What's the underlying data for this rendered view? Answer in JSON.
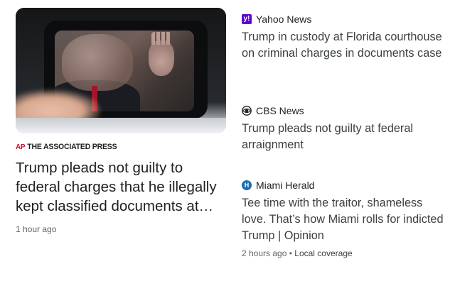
{
  "top_story": {
    "image_alt": "Photo of a person waving from behind a car window",
    "source": {
      "logo_text": "AP",
      "name": "THE ASSOCIATED PRESS"
    },
    "headline": "Trump pleads not guilty to federal charges that he illegally kept classified documents at…",
    "time": "1 hour ago"
  },
  "stories": [
    {
      "source": "Yahoo News",
      "icon": "yahoo-news-icon",
      "icon_glyph": "y!",
      "headline": "Trump in custody at Florida courthouse on criminal charges in documents case"
    },
    {
      "source": "CBS News",
      "icon": "cbs-eye-icon",
      "headline": "Trump pleads not guilty at federal arraignment"
    },
    {
      "source": "Miami Herald",
      "icon": "miami-herald-icon",
      "icon_glyph": "H",
      "headline": "Tee time with the traitor, shameless love. That’s how Miami rolls for indicted Trump | Opinion",
      "time": "2 hours ago",
      "separator": "•",
      "tag": "Local coverage"
    }
  ],
  "colors": {
    "ap_red": "#c8102e",
    "yahoo_purple": "#6001d2",
    "miami_blue": "#1a6db3",
    "text_primary": "#202124",
    "text_secondary": "#5f6368"
  }
}
